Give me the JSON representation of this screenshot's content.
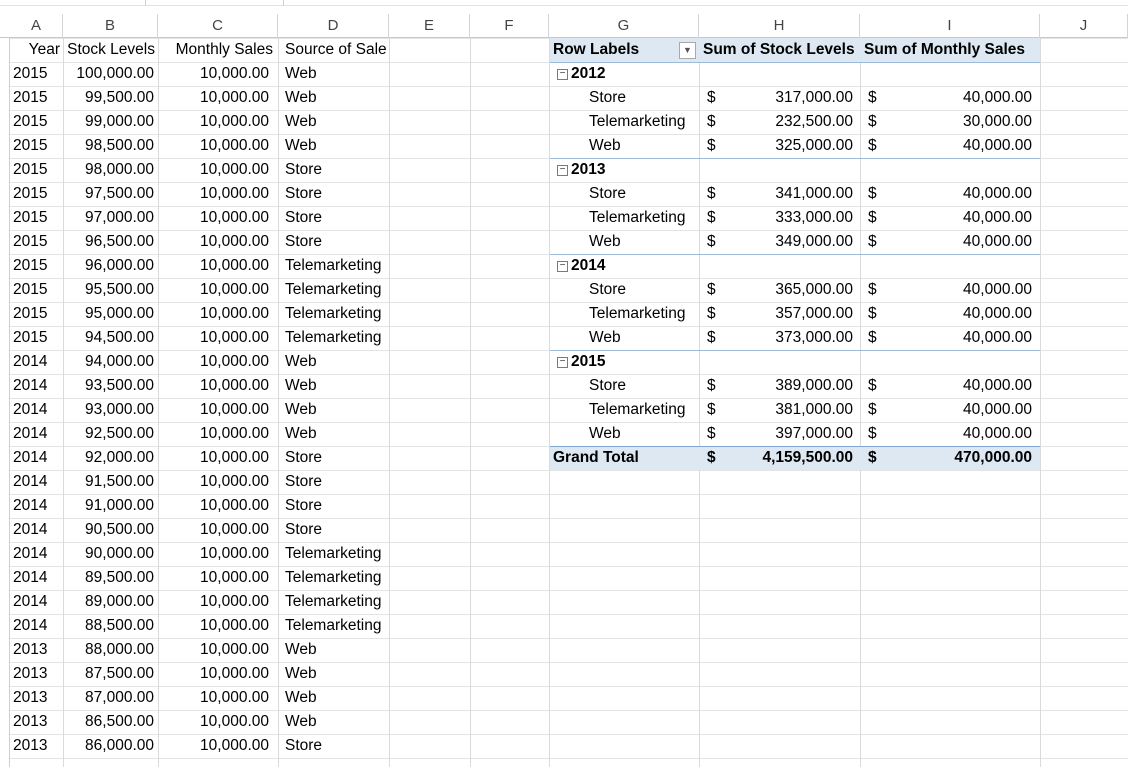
{
  "columns": [
    "A",
    "B",
    "C",
    "D",
    "E",
    "F",
    "G",
    "H",
    "I",
    "J"
  ],
  "source_headers": [
    "Year",
    "Stock Levels",
    "Monthly Sales",
    "Source of Sale"
  ],
  "source_rows": [
    [
      "2015",
      "100,000.00",
      "10,000.00",
      "Web"
    ],
    [
      "2015",
      "99,500.00",
      "10,000.00",
      "Web"
    ],
    [
      "2015",
      "99,000.00",
      "10,000.00",
      "Web"
    ],
    [
      "2015",
      "98,500.00",
      "10,000.00",
      "Web"
    ],
    [
      "2015",
      "98,000.00",
      "10,000.00",
      "Store"
    ],
    [
      "2015",
      "97,500.00",
      "10,000.00",
      "Store"
    ],
    [
      "2015",
      "97,000.00",
      "10,000.00",
      "Store"
    ],
    [
      "2015",
      "96,500.00",
      "10,000.00",
      "Store"
    ],
    [
      "2015",
      "96,000.00",
      "10,000.00",
      "Telemarketing"
    ],
    [
      "2015",
      "95,500.00",
      "10,000.00",
      "Telemarketing"
    ],
    [
      "2015",
      "95,000.00",
      "10,000.00",
      "Telemarketing"
    ],
    [
      "2015",
      "94,500.00",
      "10,000.00",
      "Telemarketing"
    ],
    [
      "2014",
      "94,000.00",
      "10,000.00",
      "Web"
    ],
    [
      "2014",
      "93,500.00",
      "10,000.00",
      "Web"
    ],
    [
      "2014",
      "93,000.00",
      "10,000.00",
      "Web"
    ],
    [
      "2014",
      "92,500.00",
      "10,000.00",
      "Web"
    ],
    [
      "2014",
      "92,000.00",
      "10,000.00",
      "Store"
    ],
    [
      "2014",
      "91,500.00",
      "10,000.00",
      "Store"
    ],
    [
      "2014",
      "91,000.00",
      "10,000.00",
      "Store"
    ],
    [
      "2014",
      "90,500.00",
      "10,000.00",
      "Store"
    ],
    [
      "2014",
      "90,000.00",
      "10,000.00",
      "Telemarketing"
    ],
    [
      "2014",
      "89,500.00",
      "10,000.00",
      "Telemarketing"
    ],
    [
      "2014",
      "89,000.00",
      "10,000.00",
      "Telemarketing"
    ],
    [
      "2014",
      "88,500.00",
      "10,000.00",
      "Telemarketing"
    ],
    [
      "2013",
      "88,000.00",
      "10,000.00",
      "Web"
    ],
    [
      "2013",
      "87,500.00",
      "10,000.00",
      "Web"
    ],
    [
      "2013",
      "87,000.00",
      "10,000.00",
      "Web"
    ],
    [
      "2013",
      "86,500.00",
      "10,000.00",
      "Web"
    ],
    [
      "2013",
      "86,000.00",
      "10,000.00",
      "Store"
    ]
  ],
  "pivot": {
    "headers": [
      "Row Labels",
      "Sum of Stock Levels",
      "Sum of Monthly Sales"
    ],
    "currency_symbol": "$",
    "collapse_glyph": "−",
    "dropdown_glyph": "▼",
    "groups": [
      {
        "year": "2012",
        "items": [
          {
            "label": "Store",
            "stock": "317,000.00",
            "sales": "40,000.00"
          },
          {
            "label": "Telemarketing",
            "stock": "232,500.00",
            "sales": "30,000.00"
          },
          {
            "label": "Web",
            "stock": "325,000.00",
            "sales": "40,000.00"
          }
        ]
      },
      {
        "year": "2013",
        "items": [
          {
            "label": "Store",
            "stock": "341,000.00",
            "sales": "40,000.00"
          },
          {
            "label": "Telemarketing",
            "stock": "333,000.00",
            "sales": "40,000.00"
          },
          {
            "label": "Web",
            "stock": "349,000.00",
            "sales": "40,000.00"
          }
        ]
      },
      {
        "year": "2014",
        "items": [
          {
            "label": "Store",
            "stock": "365,000.00",
            "sales": "40,000.00"
          },
          {
            "label": "Telemarketing",
            "stock": "357,000.00",
            "sales": "40,000.00"
          },
          {
            "label": "Web",
            "stock": "373,000.00",
            "sales": "40,000.00"
          }
        ]
      },
      {
        "year": "2015",
        "items": [
          {
            "label": "Store",
            "stock": "389,000.00",
            "sales": "40,000.00"
          },
          {
            "label": "Telemarketing",
            "stock": "381,000.00",
            "sales": "40,000.00"
          },
          {
            "label": "Web",
            "stock": "397,000.00",
            "sales": "40,000.00"
          }
        ]
      }
    ],
    "grand_total": {
      "label": "Grand Total",
      "stock": "4,159,500.00",
      "sales": "470,000.00"
    }
  },
  "colors": {
    "pivot_header_bg": "#dde8f3",
    "pivot_line": "#9bbbd9",
    "grid": "#dadada"
  }
}
